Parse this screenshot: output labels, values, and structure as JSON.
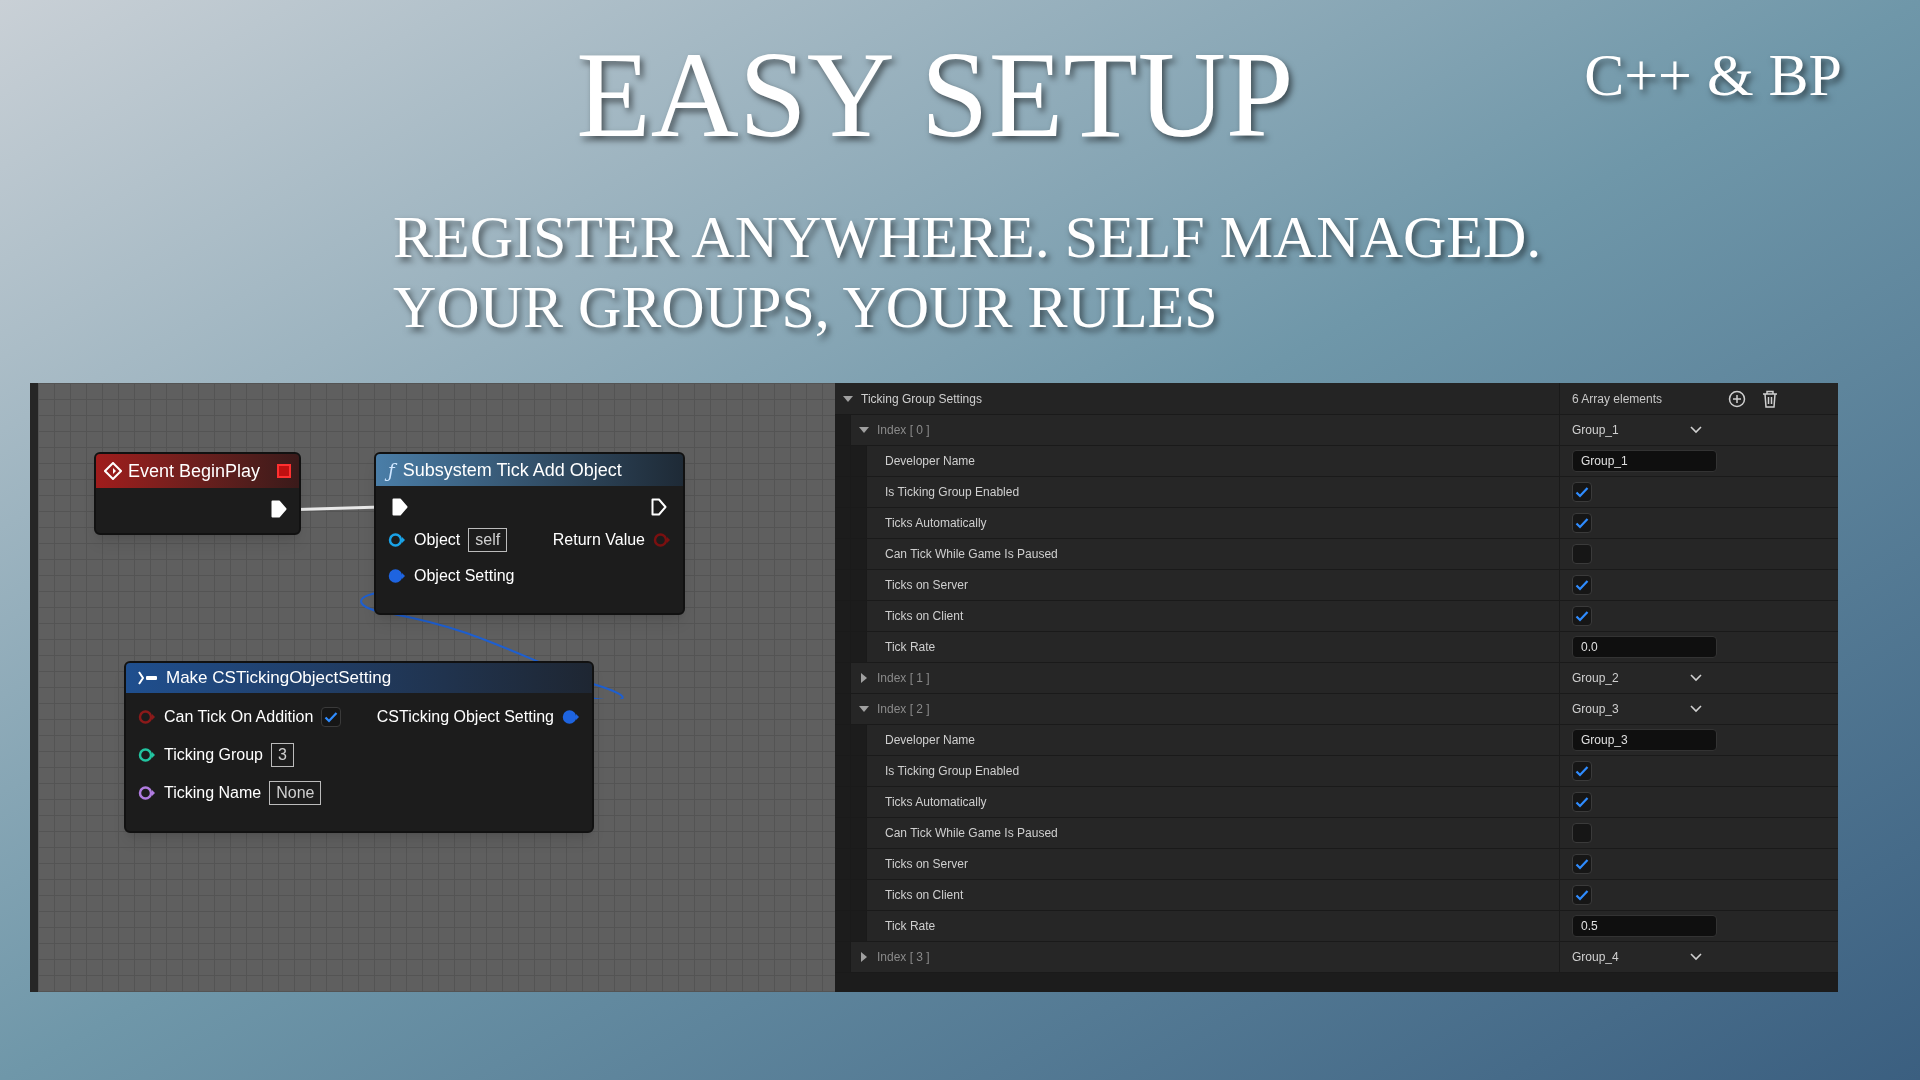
{
  "headline": "EASY SETUP",
  "corner_label": "C++ & BP",
  "subtitle_lines": [
    "REGISTER ANYWHERE. SELF MANAGED.",
    "YOUR GROUPS, YOUR RULES"
  ],
  "graph": {
    "event_node": {
      "title": "Event BeginPlay"
    },
    "call_node": {
      "icon": "ƒ",
      "title": "Subsystem Tick Add Object",
      "object_label": "Object",
      "object_value": "self",
      "return_label": "Return Value",
      "setting_label": "Object Setting"
    },
    "make_node": {
      "title": "Make CSTickingObjectSetting",
      "output_label": "CSTicking Object Setting",
      "pins": [
        {
          "label": "Can Tick On Addition",
          "kind": "checkbox",
          "checked": true,
          "color": "#8b1a1a"
        },
        {
          "label": "Ticking Group",
          "kind": "field",
          "value": "3",
          "color": "#22c4a0"
        },
        {
          "label": "Ticking Name",
          "kind": "field",
          "value": "None",
          "color": "#b07ce0"
        }
      ]
    }
  },
  "details": {
    "title": "Ticking Group Settings",
    "expanded": true,
    "count": "6 Array elements",
    "items": [
      {
        "label": "Index [ 0 ]",
        "value": "Group_1",
        "expanded": true,
        "children": [
          {
            "label": "Developer Name",
            "kind": "text",
            "value": "Group_1"
          },
          {
            "label": "Is Ticking Group Enabled",
            "kind": "checkbox",
            "checked": true
          },
          {
            "label": "Ticks Automatically",
            "kind": "checkbox",
            "checked": true
          },
          {
            "label": "Can Tick While Game Is Paused",
            "kind": "checkbox",
            "checked": false
          },
          {
            "label": "Ticks on Server",
            "kind": "checkbox",
            "checked": true
          },
          {
            "label": "Ticks on Client",
            "kind": "checkbox",
            "checked": true
          },
          {
            "label": "Tick Rate",
            "kind": "text",
            "value": "0.0"
          }
        ]
      },
      {
        "label": "Index [ 1 ]",
        "value": "Group_2",
        "expanded": false
      },
      {
        "label": "Index [ 2 ]",
        "value": "Group_3",
        "expanded": true,
        "children": [
          {
            "label": "Developer Name",
            "kind": "text",
            "value": "Group_3"
          },
          {
            "label": "Is Ticking Group Enabled",
            "kind": "checkbox",
            "checked": true
          },
          {
            "label": "Ticks Automatically",
            "kind": "checkbox",
            "checked": true
          },
          {
            "label": "Can Tick While Game Is Paused",
            "kind": "checkbox",
            "checked": false
          },
          {
            "label": "Ticks on Server",
            "kind": "checkbox",
            "checked": true
          },
          {
            "label": "Ticks on Client",
            "kind": "checkbox",
            "checked": true
          },
          {
            "label": "Tick Rate",
            "kind": "text",
            "value": "0.5"
          }
        ]
      },
      {
        "label": "Index [ 3 ]",
        "value": "Group_4",
        "expanded": false
      }
    ]
  }
}
